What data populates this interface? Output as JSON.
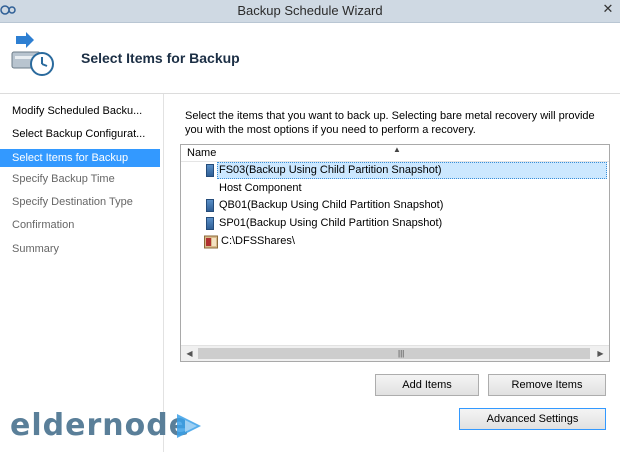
{
  "window": {
    "title": "Backup Schedule Wizard"
  },
  "header": {
    "heading": "Select Items for Backup"
  },
  "nav": {
    "items": [
      {
        "label": "Modify Scheduled Backu...",
        "state": "done"
      },
      {
        "label": "Select Backup Configurat...",
        "state": "done"
      },
      {
        "label": "Select Items for Backup",
        "state": "active"
      },
      {
        "label": "Specify Backup Time",
        "state": "pending"
      },
      {
        "label": "Specify Destination Type",
        "state": "pending"
      },
      {
        "label": "Confirmation",
        "state": "pending"
      },
      {
        "label": "Summary",
        "state": "pending"
      }
    ]
  },
  "main": {
    "instructions": "Select the items that you want to back up. Selecting bare metal recovery will provide you with the most options if you need to perform a recovery.",
    "list": {
      "column_header": "Name",
      "items": [
        {
          "label": "FS03(Backup Using Child Partition Snapshot)",
          "icon": "vm-icon",
          "selected": true
        },
        {
          "label": "Host Component",
          "icon": "none",
          "selected": false
        },
        {
          "label": "QB01(Backup Using Child Partition Snapshot)",
          "icon": "vm-icon",
          "selected": false
        },
        {
          "label": "SP01(Backup Using Child Partition Snapshot)",
          "icon": "vm-icon",
          "selected": false
        },
        {
          "label": "C:\\DFSShares\\",
          "icon": "folder-icon",
          "selected": false
        }
      ]
    },
    "buttons": {
      "add": "Add Items",
      "remove": "Remove Items",
      "advanced": "Advanced Settings"
    }
  },
  "watermark": {
    "text": "eldernode"
  },
  "colors": {
    "accent": "#3399ff",
    "selection": "#cce8ff",
    "titlebar": "#cfd9e3"
  }
}
